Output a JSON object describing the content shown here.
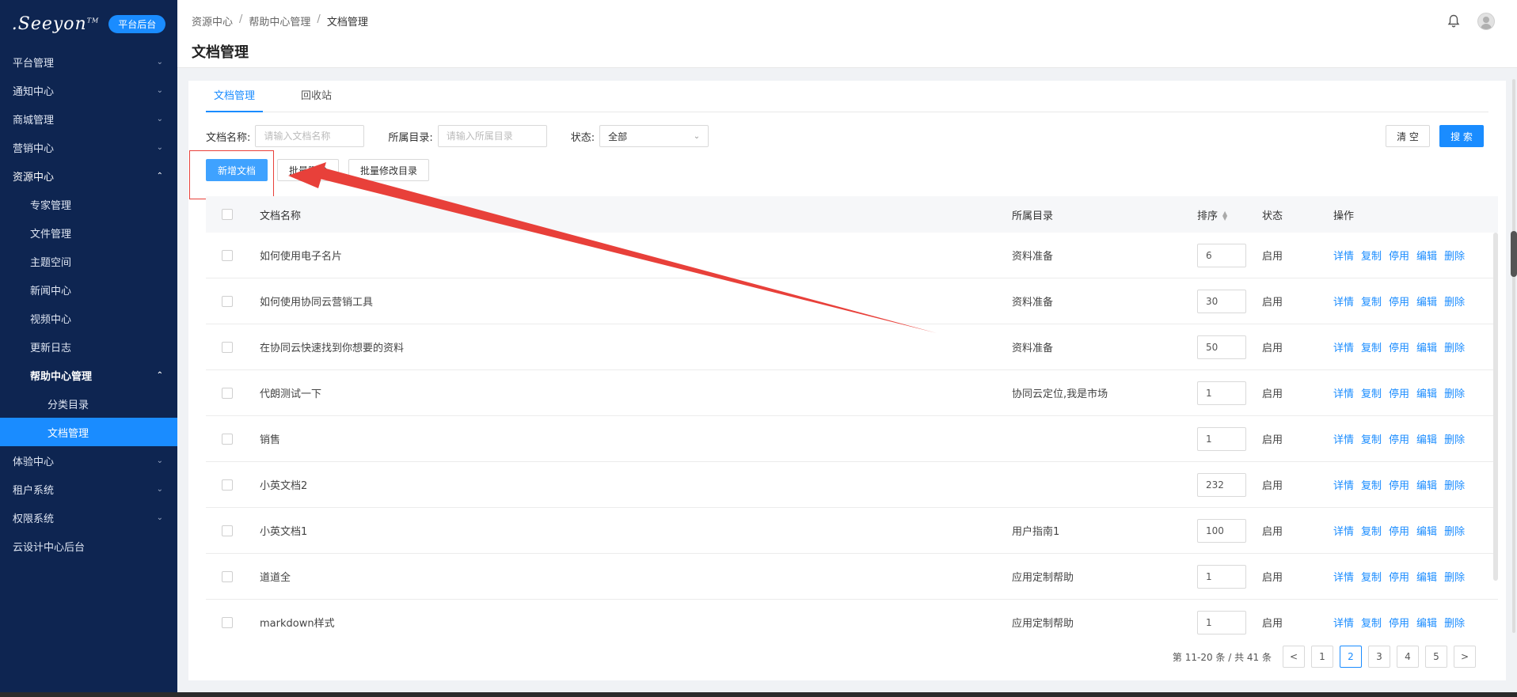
{
  "logo": {
    "text": ".Seeyon",
    "tm": "TM",
    "badge": "平台后台"
  },
  "sidebar": {
    "items": [
      {
        "label": "平台管理",
        "level": 0,
        "chev": "⌄"
      },
      {
        "label": "通知中心",
        "level": 0,
        "chev": "⌄"
      },
      {
        "label": "商城管理",
        "level": 0,
        "chev": "⌄"
      },
      {
        "label": "营销中心",
        "level": 0,
        "chev": "⌄"
      },
      {
        "label": "资源中心",
        "level": 0,
        "chev": "⌃"
      },
      {
        "label": "专家管理",
        "level": 1,
        "chev": ""
      },
      {
        "label": "文件管理",
        "level": 1,
        "chev": ""
      },
      {
        "label": "主题空间",
        "level": 1,
        "chev": ""
      },
      {
        "label": "新闻中心",
        "level": 1,
        "chev": ""
      },
      {
        "label": "视频中心",
        "level": 1,
        "chev": ""
      },
      {
        "label": "更新日志",
        "level": 1,
        "chev": ""
      },
      {
        "label": "帮助中心管理",
        "level": 1,
        "chev": "⌃"
      },
      {
        "label": "分类目录",
        "level": 2,
        "chev": ""
      },
      {
        "label": "文档管理",
        "level": 2,
        "chev": ""
      },
      {
        "label": "体验中心",
        "level": 0,
        "chev": "⌄"
      },
      {
        "label": "租户系统",
        "level": 0,
        "chev": "⌄"
      },
      {
        "label": "权限系统",
        "level": 0,
        "chev": "⌄"
      },
      {
        "label": "云设计中心后台",
        "level": 0,
        "chev": ""
      }
    ]
  },
  "header": {
    "breadcrumb": [
      "资源中心",
      "帮助中心管理",
      "文档管理"
    ],
    "title": "文档管理"
  },
  "tabs": [
    "文档管理",
    "回收站"
  ],
  "filters": {
    "name_label": "文档名称:",
    "name_placeholder": "请输入文档名称",
    "dir_label": "所属目录:",
    "dir_placeholder": "请输入所属目录",
    "status_label": "状态:",
    "status_value": "全部"
  },
  "buttons": {
    "clear": "清 空",
    "search": "搜 索",
    "add": "新增文档",
    "batch_delete": "批量删除",
    "batch_move": "批量修改目录"
  },
  "table": {
    "columns": {
      "name": "文档名称",
      "dir": "所属目录",
      "order": "排序",
      "status": "状态",
      "ops": "操作"
    },
    "ops": [
      "详情",
      "复制",
      "停用",
      "编辑",
      "删除"
    ],
    "rows": [
      {
        "name": "如何使用电子名片",
        "dir": "资料准备",
        "order": "6",
        "status": "启用"
      },
      {
        "name": "如何使用协同云营销工具",
        "dir": "资料准备",
        "order": "30",
        "status": "启用"
      },
      {
        "name": "在协同云快速找到你想要的资料",
        "dir": "资料准备",
        "order": "50",
        "status": "启用"
      },
      {
        "name": "代朗测试一下",
        "dir": "协同云定位,我是市场",
        "order": "1",
        "status": "启用"
      },
      {
        "name": "销售",
        "dir": "",
        "order": "1",
        "status": "启用"
      },
      {
        "name": "小英文档2",
        "dir": "",
        "order": "232",
        "status": "启用"
      },
      {
        "name": "小英文档1",
        "dir": "用户指南1",
        "order": "100",
        "status": "启用"
      },
      {
        "name": "道道全",
        "dir": "应用定制帮助",
        "order": "1",
        "status": "启用"
      },
      {
        "name": "markdown样式",
        "dir": "应用定制帮助",
        "order": "1",
        "status": "启用"
      }
    ]
  },
  "pagination": {
    "info": "第 11-20 条 / 共 41 条",
    "pages": [
      "1",
      "2",
      "3",
      "4",
      "5"
    ],
    "current": "2",
    "prev": "<",
    "next": ">"
  },
  "colors": {
    "sidebar_bg": "#0e2551",
    "accent": "#1a8cff",
    "annotation": "#e8403a"
  },
  "icons": {
    "bell": "bell-icon",
    "avatar": "avatar-icon"
  }
}
